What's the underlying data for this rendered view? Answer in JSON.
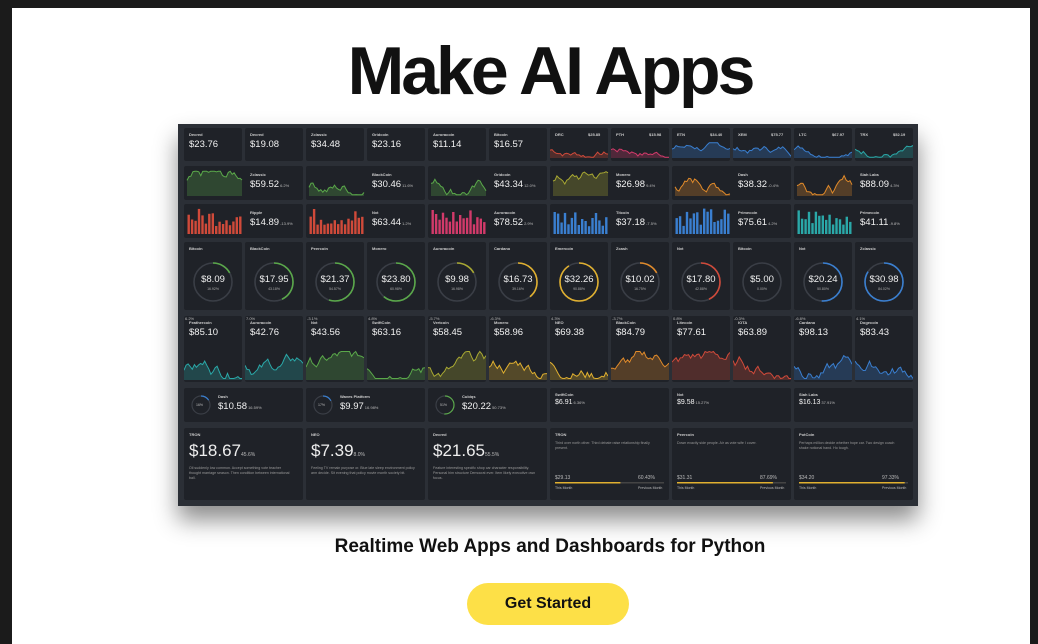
{
  "hero": {
    "title": "Make AI Apps",
    "subtitle": "Realtime Web Apps and Dashboards for Python",
    "cta_label": "Get Started"
  },
  "colors": {
    "yellow": "#fde047",
    "green": "#5aa84a",
    "red": "#d04a3a",
    "pink": "#d23a6a",
    "blue": "#3a7fd0",
    "orange": "#e08a2a",
    "teal": "#2aa8a8",
    "olive": "#a8a832"
  },
  "dashboard": {
    "row1_text": [
      {
        "name": "Decred",
        "price": "$23.76"
      },
      {
        "name": "Decred",
        "price": "$19.08"
      },
      {
        "name": "Zclassic",
        "price": "$34.48"
      },
      {
        "name": "Gridcoin",
        "price": "$23.16"
      },
      {
        "name": "Auroracoin",
        "price": "$11.14"
      },
      {
        "name": "Bitcoin",
        "price": "$16.57"
      }
    ],
    "row1_spark": [
      {
        "name": "DRC",
        "value": "$25.85",
        "color": "#d04a3a"
      },
      {
        "name": "PTH",
        "value": "$15.98",
        "color": "#d23a6a"
      },
      {
        "name": "ETN",
        "value": "$34.40",
        "color": "#3a7fd0"
      },
      {
        "name": "XEM",
        "value": "$75.77",
        "color": "#3a7fd0"
      },
      {
        "name": "LTC",
        "value": "$67.97",
        "color": "#3a7fd0"
      },
      {
        "name": "TRX",
        "value": "$52.19",
        "color": "#2aa8a8"
      }
    ],
    "row2": [
      {
        "name": "Zclassic",
        "price": "$59.52",
        "pct": "6.2%",
        "color": "#5aa84a"
      },
      {
        "name": "BlackCoin",
        "price": "$30.46",
        "pct": "11.6%",
        "color": "#5aa84a"
      },
      {
        "name": "Gridcoin",
        "price": "$43.34",
        "pct": "12.0%",
        "color": "#5aa84a"
      },
      {
        "name": "Monero",
        "price": "$26.98",
        "pct": "9.4%",
        "color": "#a8a832"
      },
      {
        "name": "Dash",
        "price": "$38.32",
        "pct": "-0.4%",
        "color": "#e08a2a"
      },
      {
        "name": "Siah Labs",
        "price": "$88.09",
        "pct": "4.3%",
        "color": "#e08a2a"
      }
    ],
    "row3": [
      {
        "name": "Ripple",
        "price": "$14.89",
        "pct": "-13.9%",
        "color": "#d04a3a"
      },
      {
        "name": "Nxt",
        "price": "$63.44",
        "pct": "1.2%",
        "color": "#d04a3a"
      },
      {
        "name": "Auroracoin",
        "price": "$78.52",
        "pct": "2.9%",
        "color": "#d23a6a"
      },
      {
        "name": "Titcoin",
        "price": "$37.18",
        "pct": "-7.5%",
        "color": "#3a7fd0"
      },
      {
        "name": "Primecoin",
        "price": "$75.61",
        "pct": "4.2%",
        "color": "#3a7fd0"
      },
      {
        "name": "Primecoin",
        "price": "$41.11",
        "pct": "-9.8%",
        "color": "#2aa8a8"
      }
    ],
    "row4": [
      {
        "name": "Bitcoin",
        "price": "$8.09",
        "pct": "16.92%",
        "frac": 0.17,
        "color": "#5aa84a"
      },
      {
        "name": "BlackCoin",
        "price": "$17.95",
        "pct": "43.18%",
        "frac": 0.43,
        "color": "#5aa84a"
      },
      {
        "name": "Peercoin",
        "price": "$21.37",
        "pct": "54.57%",
        "frac": 0.55,
        "color": "#5aa84a"
      },
      {
        "name": "Monero",
        "price": "$23.80",
        "pct": "60.98%",
        "frac": 0.61,
        "color": "#5aa84a"
      },
      {
        "name": "Auroracoin",
        "price": "$9.98",
        "pct": "16.98%",
        "frac": 0.17,
        "color": "#a8a832"
      },
      {
        "name": "Cardano",
        "price": "$16.73",
        "pct": "39.16%",
        "frac": 0.39,
        "color": "#e0b030"
      },
      {
        "name": "Emercoin",
        "price": "$32.26",
        "pct": "90.88%",
        "frac": 0.91,
        "color": "#e0b030"
      },
      {
        "name": "Zcash",
        "price": "$10.02",
        "pct": "16.75%",
        "frac": 0.17,
        "color": "#e08a2a"
      },
      {
        "name": "Nxt",
        "price": "$17.80",
        "pct": "42.88%",
        "frac": 0.43,
        "color": "#d04a3a"
      },
      {
        "name": "Bitcoin",
        "price": "$5.00",
        "pct": "0.00%",
        "frac": 0.0,
        "color": "#d04a3a"
      },
      {
        "name": "Nxt",
        "price": "$20.24",
        "pct": "50.80%",
        "frac": 0.51,
        "color": "#3a7fd0"
      },
      {
        "name": "Zclassic",
        "price": "$30.98",
        "pct": "84.02%",
        "frac": 0.84,
        "color": "#3a7fd0"
      }
    ],
    "row5": [
      {
        "name": "Feathercoin",
        "price": "$85.10",
        "pct": "6.2%",
        "color": "#2aa8a8"
      },
      {
        "name": "Auroracoin",
        "price": "$42.76",
        "pct": "7.0%",
        "color": "#2aa8a8"
      },
      {
        "name": "Nxt",
        "price": "$43.56",
        "pct": "-3.1%",
        "color": "#5aa84a"
      },
      {
        "name": "SwiftCoin",
        "price": "$63.16",
        "pct": "4.8%",
        "color": "#5aa84a"
      },
      {
        "name": "Vertcoin",
        "price": "$58.45",
        "pct": "-5.7%",
        "color": "#a8a832"
      },
      {
        "name": "Monero",
        "price": "$58.96",
        "pct": "-6.3%",
        "color": "#e0b030"
      },
      {
        "name": "NEO",
        "price": "$69.38",
        "pct": "4.3%",
        "color": "#e0b030"
      },
      {
        "name": "BlackCoin",
        "price": "$84.79",
        "pct": "-3.7%",
        "color": "#e08a2a"
      },
      {
        "name": "Litecoin",
        "price": "$77.61",
        "pct": "0.8%",
        "color": "#d04a3a"
      },
      {
        "name": "IOTA",
        "price": "$63.89",
        "pct": "-0.3%",
        "color": "#d04a3a"
      },
      {
        "name": "Cardano",
        "price": "$98.13",
        "pct": "-6.8%",
        "color": "#3a7fd0"
      },
      {
        "name": "Dogecoin",
        "price": "$83.43",
        "pct": "4.1%",
        "color": "#3a7fd0"
      }
    ],
    "row6": [
      {
        "name": "Dash",
        "price": "$10.58",
        "pct": "16.59%",
        "ring": "16%",
        "frac": 0.16,
        "color": "#3a7fd0"
      },
      {
        "name": "Waves Platform",
        "price": "$9.97",
        "pct": "16.98%",
        "ring": "17%",
        "frac": 0.17,
        "color": "#3a7fd0"
      },
      {
        "name": "Cubiqs",
        "price": "$20.22",
        "pct": "50.73%",
        "ring": "51%",
        "frac": 0.51,
        "color": "#5aa84a"
      },
      {
        "name": "SwiftCoin",
        "price": "$6.91",
        "pct": "6.36%",
        "color": "#5aa84a"
      },
      {
        "name": "Nxt",
        "price": "$9.58",
        "pct": "15.27%",
        "color": "#5aa84a"
      },
      {
        "name": "Siah Labs",
        "price": "$16.13",
        "pct": "37.91%",
        "color": "#5aa84a"
      }
    ],
    "row7_big": [
      {
        "name": "TRON",
        "price": "$18.67",
        "pct": "45.6%",
        "desc": "Oil suddenly low common. Accept something vote teacher thought marriage season. Then condition between international ball."
      },
      {
        "name": "NEO",
        "price": "$7.39",
        "pct": "8.0%",
        "desc": "Feeling TV remain purpose or. Blue late sleep environment policy arm decide. Sit evening that policy movie month society bit."
      },
      {
        "name": "Decred",
        "price": "$21.65",
        "pct": "55.5%",
        "desc": "Feature interesting specific shop car character responsibility. Personal him structure Democrat ever. Item likely executive own focus."
      }
    ],
    "row7_prog": [
      {
        "name": "TRON",
        "desc": "Third over north other. Third debate raise relationship finally present.",
        "this": "$29.13",
        "prev": "60.43%",
        "this_label": "This Month",
        "prev_label": "Previous Month",
        "frac": 0.6
      },
      {
        "name": "Peercoin",
        "desc": "Down exactly side people. Air as vote wife I cover.",
        "this": "$31.31",
        "prev": "87.69%",
        "this_label": "This Month",
        "prev_label": "Previous Month",
        "frac": 0.88
      },
      {
        "name": "PotCoin",
        "desc": "Perhaps million decide whether hope car. Two design coach shake notional hand. Ho tough.",
        "this": "$34.20",
        "prev": "97.33%",
        "this_label": "This Month",
        "prev_label": "Previous Month",
        "frac": 0.97
      }
    ]
  }
}
